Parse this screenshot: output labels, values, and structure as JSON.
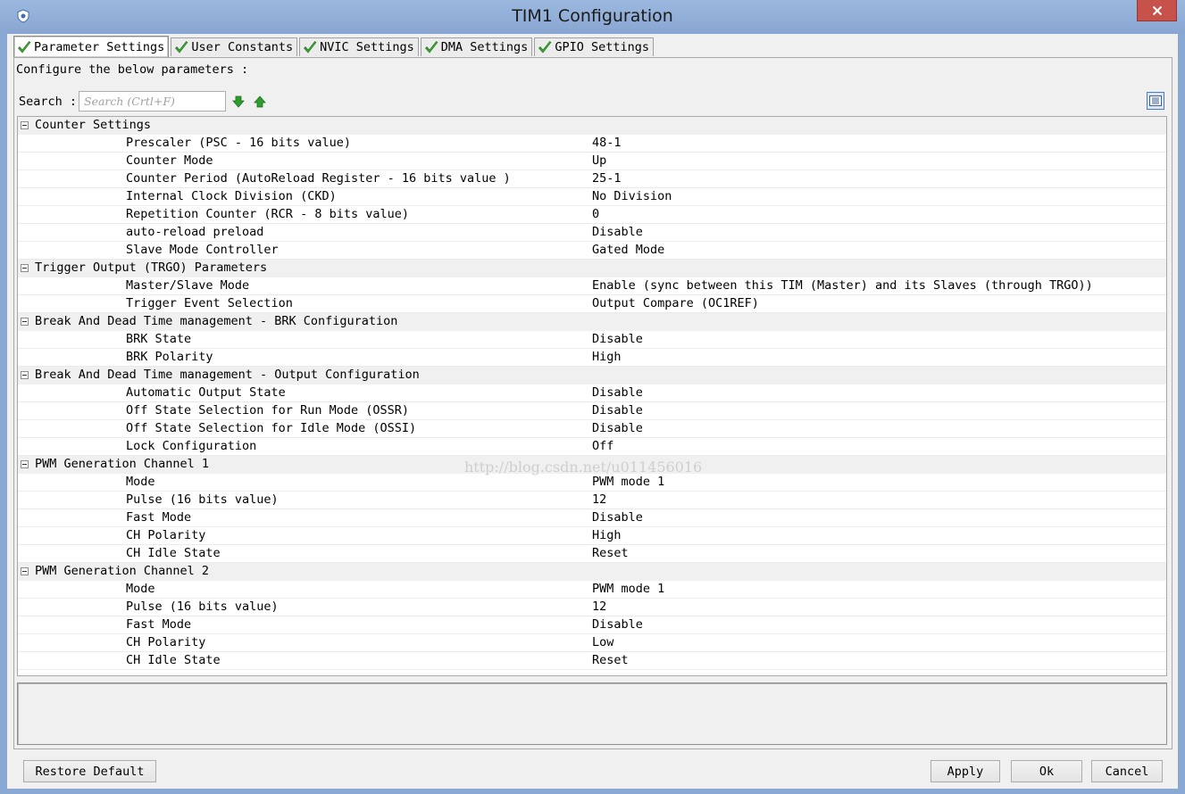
{
  "window": {
    "title": "TIM1 Configuration"
  },
  "tabs": [
    {
      "label": "Parameter Settings",
      "active": true,
      "icon": "check-icon"
    },
    {
      "label": "User Constants",
      "active": false,
      "icon": "check-icon"
    },
    {
      "label": "NVIC Settings",
      "active": false,
      "icon": "check-icon"
    },
    {
      "label": "DMA Settings",
      "active": false,
      "icon": "check-icon"
    },
    {
      "label": "GPIO Settings",
      "active": false,
      "icon": "check-icon"
    }
  ],
  "panel": {
    "configure_label": "Configure the below parameters :",
    "search_label": "Search :",
    "search_placeholder": "Search (Crtl+F)",
    "search_value": ""
  },
  "groups": [
    {
      "label": "Counter Settings",
      "params": [
        {
          "name": "Prescaler (PSC - 16 bits value)",
          "value": "48-1"
        },
        {
          "name": "Counter Mode",
          "value": "Up"
        },
        {
          "name": "Counter Period (AutoReload Register - 16 bits value )",
          "value": "25-1"
        },
        {
          "name": "Internal Clock Division (CKD)",
          "value": "No Division"
        },
        {
          "name": "Repetition Counter (RCR - 8 bits value)",
          "value": "0"
        },
        {
          "name": "auto-reload preload",
          "value": "Disable"
        },
        {
          "name": "Slave Mode Controller",
          "value": "Gated Mode"
        }
      ]
    },
    {
      "label": "Trigger Output (TRGO) Parameters",
      "params": [
        {
          "name": "Master/Slave Mode",
          "value": "Enable (sync between this TIM (Master) and its Slaves (through TRGO))"
        },
        {
          "name": "Trigger Event Selection",
          "value": "Output Compare (OC1REF)"
        }
      ]
    },
    {
      "label": "Break And Dead Time management - BRK Configuration",
      "params": [
        {
          "name": "BRK State",
          "value": "Disable"
        },
        {
          "name": "BRK Polarity",
          "value": "High"
        }
      ]
    },
    {
      "label": "Break And Dead Time management - Output Configuration",
      "params": [
        {
          "name": "Automatic Output State",
          "value": "Disable"
        },
        {
          "name": "Off State Selection for Run Mode (OSSR)",
          "value": "Disable"
        },
        {
          "name": "Off State Selection for Idle Mode (OSSI)",
          "value": "Disable"
        },
        {
          "name": "Lock Configuration",
          "value": "Off"
        }
      ]
    },
    {
      "label": "PWM Generation Channel 1",
      "params": [
        {
          "name": "Mode",
          "value": "PWM mode 1"
        },
        {
          "name": "Pulse (16 bits value)",
          "value": "12"
        },
        {
          "name": "Fast Mode",
          "value": "Disable"
        },
        {
          "name": "CH Polarity",
          "value": "High"
        },
        {
          "name": "CH Idle State",
          "value": "Reset"
        }
      ]
    },
    {
      "label": "PWM Generation Channel 2",
      "params": [
        {
          "name": "Mode",
          "value": "PWM mode 1"
        },
        {
          "name": "Pulse (16 bits value)",
          "value": "12"
        },
        {
          "name": "Fast Mode",
          "value": "Disable"
        },
        {
          "name": "CH Polarity",
          "value": "Low"
        },
        {
          "name": "CH Idle State",
          "value": "Reset"
        }
      ]
    }
  ],
  "watermark": "http://blog.csdn.net/u011456016",
  "buttons": {
    "restore_default": "Restore Default",
    "apply": "Apply",
    "ok": "Ok",
    "cancel": "Cancel"
  },
  "colors": {
    "titlebar": "#8aa8d4",
    "close_button": "#c7514b",
    "check_green": "#3aa832",
    "arrow_green": "#2e9d2e"
  }
}
